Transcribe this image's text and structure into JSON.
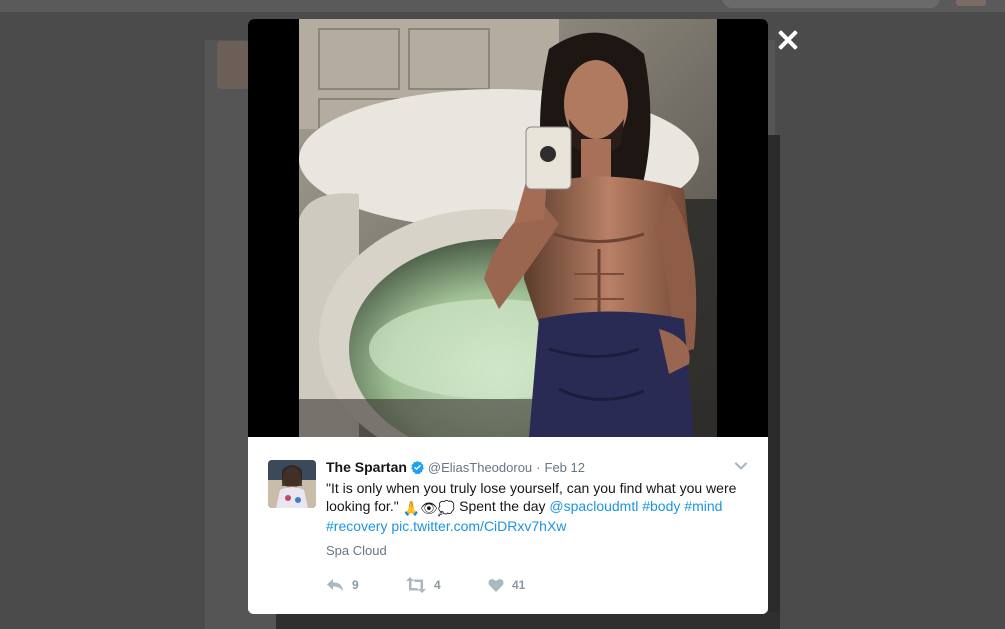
{
  "lightbox": {
    "close_label": "Close",
    "image_alt": "Mirror selfie of a shirtless man holding a phone, towel around waist, next to a float pod"
  },
  "tweet": {
    "fullname": "The Spartan",
    "handle": "@EliasTheodorou",
    "separator": "·",
    "time": "Feb 12",
    "text_part1": "\"It is only when you truly lose yourself, can you find what you were looking for.\" ",
    "emoji_folded_hands": "🙏",
    "emoji_eye": "👁",
    "emoji_thought": "💭",
    "text_part2": " Spent the day ",
    "mention": "@spacloudmtl",
    "hashtag_body": "#body",
    "hashtag_mind": "#mind",
    "hashtag_recovery": "#recovery",
    "pic_link": "pic.twitter.com/CiDRxv7hXw",
    "place": "Spa Cloud",
    "reply_count": "9",
    "retweet_count": "4",
    "like_count": "41"
  },
  "colors": {
    "link": "#1b95e0",
    "verified": "#1da1f2",
    "muted": "#657786",
    "action_icon": "#aab8c2"
  }
}
